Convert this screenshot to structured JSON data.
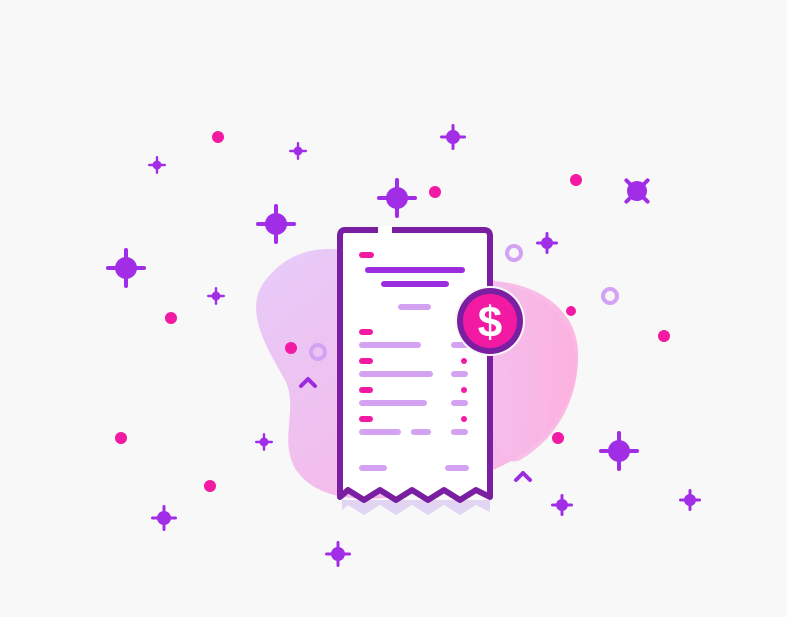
{
  "illustration": {
    "subject": "receipt-with-dollar-coin",
    "coin_symbol": "$",
    "colors": {
      "background": "#f8f8f8",
      "outline": "#7a1fa2",
      "accent_purple": "#9b2ce0",
      "sparkle_purple": "#a12ee6",
      "light_purple": "#d4a2f2",
      "magenta": "#f21aa3",
      "blob_left": "#e8c8f8",
      "blob_right": "#fbb6e6",
      "paper": "#ffffff",
      "shadow": "#e4d6f2"
    }
  }
}
